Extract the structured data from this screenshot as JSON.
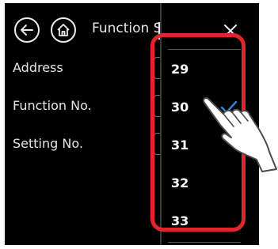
{
  "header": {
    "title": "Function S",
    "back_icon": "arrow-left-circle-icon",
    "home_icon": "home-circle-icon",
    "close_icon": "close-icon"
  },
  "form": {
    "labels": [
      "Address",
      "Function No.",
      "Setting No."
    ]
  },
  "dropdown": {
    "options": [
      "29",
      "30",
      "31",
      "32",
      "33"
    ],
    "selected": "30"
  },
  "annotation": {
    "highlight_color": "#e0262c",
    "check_color": "#2f86d6"
  }
}
